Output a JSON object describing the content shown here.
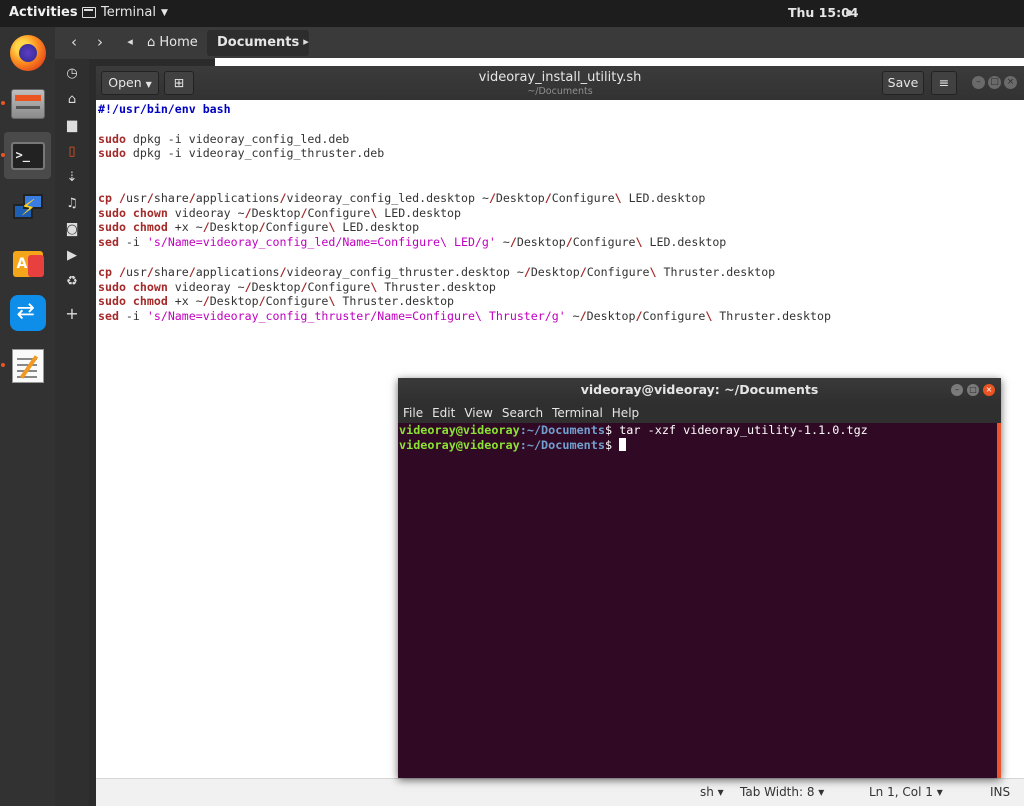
{
  "topbar": {
    "activities": "Activities",
    "app_name": "Terminal",
    "clock": "Thu 15:04"
  },
  "dock": {
    "apps": [
      "firefox-icon",
      "files-icon",
      "terminal-icon",
      "network-tool-icon",
      "software-center-icon",
      "teamviewer-icon",
      "text-editor-icon"
    ]
  },
  "files": {
    "path": [
      "Home",
      "Documents"
    ]
  },
  "gedit": {
    "open_label": "Open",
    "title": "videoray_install_utility.sh",
    "subtitle": "~/Documents",
    "save_label": "Save",
    "status": {
      "lang": "sh",
      "tab_width": "Tab Width: 8",
      "position": "Ln 1, Col 1",
      "mode": "INS"
    }
  },
  "code_lines": [
    [
      [
        "shebang",
        "#!/usr/bin/env bash"
      ]
    ],
    [],
    [
      [
        "kw",
        "sudo"
      ],
      [
        "",
        " dpkg -i videoray_config_led.deb"
      ]
    ],
    [
      [
        "kw",
        "sudo"
      ],
      [
        "",
        " dpkg -i videoray_config_thruster.deb"
      ]
    ],
    [],
    [],
    [
      [
        "kw",
        "cp"
      ],
      [
        "",
        " "
      ],
      [
        "sep",
        "/"
      ],
      [
        "",
        "usr"
      ],
      [
        "sep",
        "/"
      ],
      [
        "",
        "share"
      ],
      [
        "sep",
        "/"
      ],
      [
        "",
        "applications"
      ],
      [
        "sep",
        "/"
      ],
      [
        "",
        "videoray_config_led.desktop ~"
      ],
      [
        "sep",
        "/"
      ],
      [
        "",
        "Desktop"
      ],
      [
        "sep",
        "/"
      ],
      [
        "",
        "Configure"
      ],
      [
        "sep",
        "\\"
      ],
      [
        "",
        " LED.desktop"
      ]
    ],
    [
      [
        "kw",
        "sudo"
      ],
      [
        "",
        " "
      ],
      [
        "kw",
        "chown"
      ],
      [
        "",
        " videoray ~"
      ],
      [
        "sep",
        "/"
      ],
      [
        "",
        "Desktop"
      ],
      [
        "sep",
        "/"
      ],
      [
        "",
        "Configure"
      ],
      [
        "sep",
        "\\"
      ],
      [
        "",
        " LED.desktop"
      ]
    ],
    [
      [
        "kw",
        "sudo"
      ],
      [
        "",
        " "
      ],
      [
        "kw",
        "chmod"
      ],
      [
        "",
        " +x ~"
      ],
      [
        "sep",
        "/"
      ],
      [
        "",
        "Desktop"
      ],
      [
        "sep",
        "/"
      ],
      [
        "",
        "Configure"
      ],
      [
        "sep",
        "\\"
      ],
      [
        "",
        " LED.desktop"
      ]
    ],
    [
      [
        "kw",
        "sed"
      ],
      [
        "",
        " -i "
      ],
      [
        "str",
        "'s/Name=videoray_config_led/Name=Configure\\ LED/g'"
      ],
      [
        "",
        " ~"
      ],
      [
        "sep",
        "/"
      ],
      [
        "",
        "Desktop"
      ],
      [
        "sep",
        "/"
      ],
      [
        "",
        "Configure"
      ],
      [
        "sep",
        "\\"
      ],
      [
        "",
        " LED.desktop"
      ]
    ],
    [],
    [
      [
        "kw",
        "cp"
      ],
      [
        "",
        " "
      ],
      [
        "sep",
        "/"
      ],
      [
        "",
        "usr"
      ],
      [
        "sep",
        "/"
      ],
      [
        "",
        "share"
      ],
      [
        "sep",
        "/"
      ],
      [
        "",
        "applications"
      ],
      [
        "sep",
        "/"
      ],
      [
        "",
        "videoray_config_thruster.desktop ~"
      ],
      [
        "sep",
        "/"
      ],
      [
        "",
        "Desktop"
      ],
      [
        "sep",
        "/"
      ],
      [
        "",
        "Configure"
      ],
      [
        "sep",
        "\\"
      ],
      [
        "",
        " Thruster.desktop"
      ]
    ],
    [
      [
        "kw",
        "sudo"
      ],
      [
        "",
        " "
      ],
      [
        "kw",
        "chown"
      ],
      [
        "",
        " videoray ~"
      ],
      [
        "sep",
        "/"
      ],
      [
        "",
        "Desktop"
      ],
      [
        "sep",
        "/"
      ],
      [
        "",
        "Configure"
      ],
      [
        "sep",
        "\\"
      ],
      [
        "",
        " Thruster.desktop"
      ]
    ],
    [
      [
        "kw",
        "sudo"
      ],
      [
        "",
        " "
      ],
      [
        "kw",
        "chmod"
      ],
      [
        "",
        " +x ~"
      ],
      [
        "sep",
        "/"
      ],
      [
        "",
        "Desktop"
      ],
      [
        "sep",
        "/"
      ],
      [
        "",
        "Configure"
      ],
      [
        "sep",
        "\\"
      ],
      [
        "",
        " Thruster.desktop"
      ]
    ],
    [
      [
        "kw",
        "sed"
      ],
      [
        "",
        " -i "
      ],
      [
        "str",
        "'s/Name=videoray_config_thruster/Name=Configure\\ Thruster/g'"
      ],
      [
        "",
        " ~"
      ],
      [
        "sep",
        "/"
      ],
      [
        "",
        "Desktop"
      ],
      [
        "sep",
        "/"
      ],
      [
        "",
        "Configure"
      ],
      [
        "sep",
        "\\"
      ],
      [
        "",
        " Thruster.desktop"
      ]
    ]
  ],
  "terminal": {
    "title": "videoray@videoray: ~/Documents",
    "menu": [
      "File",
      "Edit",
      "View",
      "Search",
      "Terminal",
      "Help"
    ],
    "lines": [
      {
        "user": "videoray@videoray",
        "path": ":~/Documents",
        "prompt": "$ ",
        "cmd": "tar -xzf videoray_utility-1.1.0.tgz"
      },
      {
        "user": "videoray@videoray",
        "path": ":~/Documents",
        "prompt": "$ ",
        "cmd": ""
      }
    ]
  },
  "colors": {
    "terminal_bg": "#300a24",
    "accent": "#e95420",
    "prompt_user": "#8ae234",
    "prompt_path": "#729fcf"
  }
}
